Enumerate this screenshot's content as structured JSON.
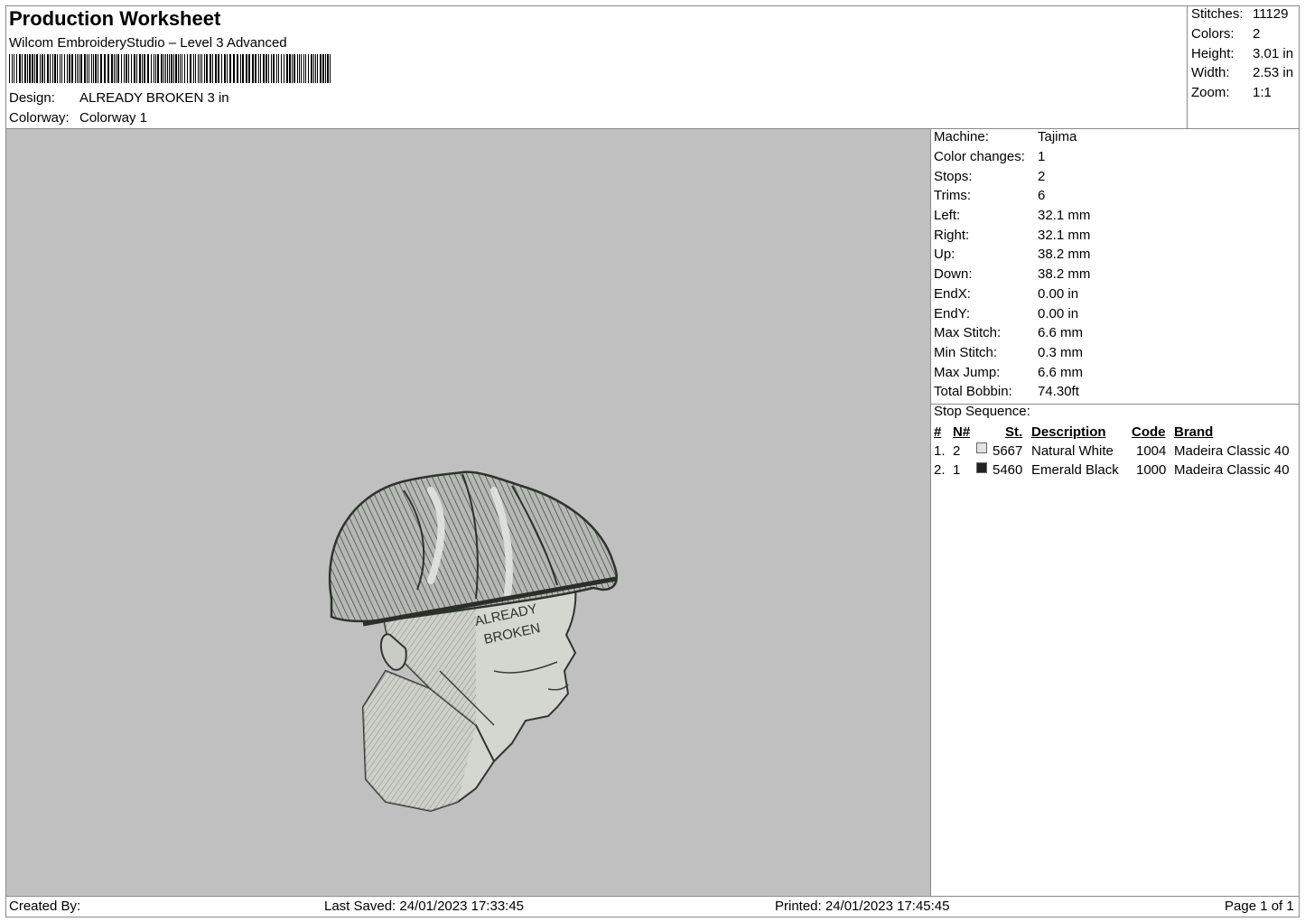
{
  "header": {
    "title": "Production Worksheet",
    "software": "Wilcom EmbroideryStudio – Level 3 Advanced",
    "design_label": "Design:",
    "design_value": "ALREADY BROKEN 3 in",
    "colorway_label": "Colorway:",
    "colorway_value": "Colorway 1"
  },
  "summary": [
    {
      "label": "Stitches:",
      "value": "11129"
    },
    {
      "label": "Colors:",
      "value": "2"
    },
    {
      "label": "Height:",
      "value": "3.01 in"
    },
    {
      "label": "Width:",
      "value": "2.53 in"
    },
    {
      "label": "Zoom:",
      "value": "1:1"
    }
  ],
  "machine_info": [
    {
      "label": "Machine:",
      "value": "Tajima"
    },
    {
      "label": "Color changes:",
      "value": "1"
    },
    {
      "label": "Stops:",
      "value": "2"
    },
    {
      "label": "Trims:",
      "value": "6"
    },
    {
      "label": "Left:",
      "value": "32.1 mm"
    },
    {
      "label": "Right:",
      "value": "32.1 mm"
    },
    {
      "label": "Up:",
      "value": "38.2 mm"
    },
    {
      "label": "Down:",
      "value": "38.2 mm"
    },
    {
      "label": "EndX:",
      "value": "0.00 in"
    },
    {
      "label": "EndY:",
      "value": "0.00 in"
    },
    {
      "label": "Max Stitch:",
      "value": "6.6 mm"
    },
    {
      "label": "Min Stitch:",
      "value": "0.3 mm"
    },
    {
      "label": "Max Jump:",
      "value": "6.6 mm"
    },
    {
      "label": "Total Bobbin:",
      "value": "74.30ft"
    }
  ],
  "stop_sequence": {
    "title": "Stop Sequence:",
    "headers": {
      "num": "#",
      "n": "N#",
      "st": "St.",
      "desc": "Description",
      "code": "Code",
      "brand": "Brand"
    },
    "rows": [
      {
        "num": "1.",
        "n": "2",
        "color": "#e2e2e2",
        "st": "5667",
        "desc": "Natural White",
        "code": "1004",
        "brand": "Madeira Classic 40"
      },
      {
        "num": "2.",
        "n": "1",
        "color": "#222222",
        "st": "5460",
        "desc": "Emerald Black",
        "code": "1000",
        "brand": "Madeira Classic 40"
      }
    ]
  },
  "design_text": {
    "line1": "ALREADY",
    "line2": "BROKEN"
  },
  "footer": {
    "created_by": "Created By:",
    "last_saved": "Last Saved: 24/01/2023 17:33:45",
    "printed": "Printed: 24/01/2023 17:45:45",
    "page": "Page 1 of 1"
  }
}
